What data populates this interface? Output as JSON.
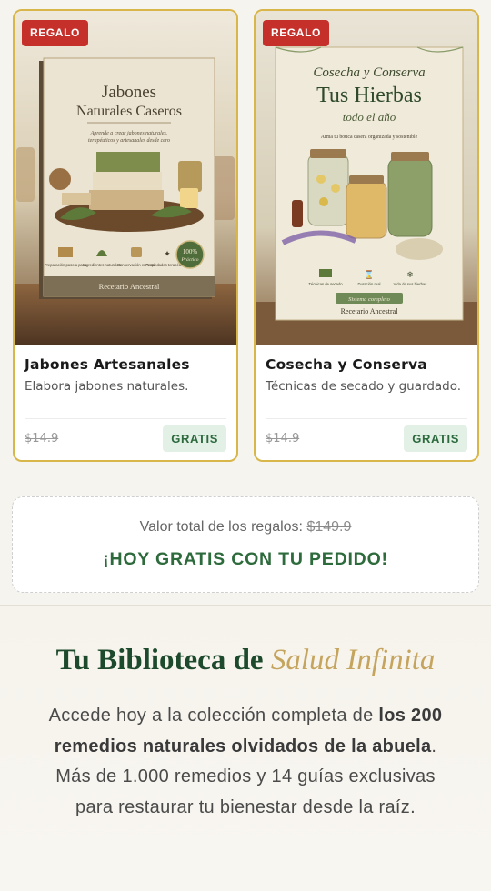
{
  "cards": [
    {
      "badge": "REGALO",
      "cover": {
        "title_line1": "Jabones",
        "title_line2": "Naturales Caseros",
        "subtitle_line1": "Aprende a crear jabones naturales,",
        "subtitle_line2": "terapéuticos y artesanales desde cero",
        "features": [
          "Preparación paso a paso",
          "Ingredientes naturales",
          "Conservación correcta",
          "Propiedades terapéuticas"
        ],
        "seal_line1": "100%",
        "seal_line2": "Práctico",
        "footer": "Recetario Ancestral"
      },
      "title": "Jabones Artesanales",
      "desc": "Elabora jabones naturales.",
      "old_price": "$14.9",
      "status": "GRATIS"
    },
    {
      "badge": "REGALO",
      "cover": {
        "title_line1": "Cosecha y Conserva",
        "title_line2": "Tus Hierbas",
        "title_line3": "todo el año",
        "subtitle": "Arma tu botica casera organizada y sostenible",
        "features": [
          "Técnicas de secado",
          "Duración real",
          "Vida de sus hierbas"
        ],
        "banner": "Sistema completo",
        "footer": "Recetario Ancestral"
      },
      "title": "Cosecha y Conserva",
      "desc": "Técnicas de secado y guardado.",
      "old_price": "$14.9",
      "status": "GRATIS"
    }
  ],
  "total": {
    "label": "Valor total de los regalos:",
    "value": "$149.9",
    "cta": "¡HOY GRATIS CON TU PEDIDO!"
  },
  "library": {
    "heading_plain": "Tu Biblioteca de",
    "heading_accent": "Salud Infinita",
    "para_1": "Accede hoy a la colección completa de",
    "para_bold": "los 200 remedios naturales olvidados de la abuela",
    "para_2": ". Más de 1.000 remedios y 14 guías exclusivas para restaurar tu bienestar desde la raíz."
  },
  "colors": {
    "card_border": "#d8b64a",
    "badge_red": "#c6302b",
    "brand_green": "#2e6b3c",
    "accent_gold": "#c5a45e"
  }
}
